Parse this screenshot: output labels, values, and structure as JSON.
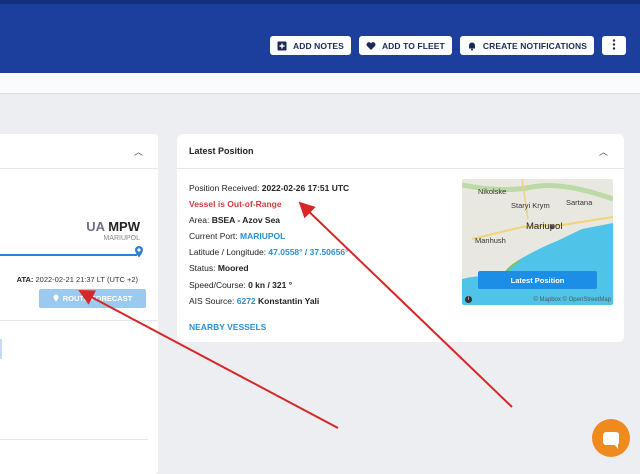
{
  "header": {
    "buttons": {
      "add_notes": "ADD NOTES",
      "add_to_fleet": "ADD TO FLEET",
      "create_notifications": "CREATE NOTIFICATIONS"
    },
    "more_icon": "vertical-dots-icon"
  },
  "voyage": {
    "dest_prefix": "UA",
    "dest_code": "MPW",
    "dest_name": "MARIUPOL",
    "ata_label": "ATA:",
    "ata_value": "2022-02-21 21:37 LT (UTC +2)",
    "route_button": "ROUTE FORECAST"
  },
  "latest_position": {
    "title": "Latest Position",
    "position_received_label": "Position Received:",
    "position_received_value": "2022-02-26 17:51 UTC",
    "status_warning": "Vessel is Out-of-Range",
    "area_label": "Area:",
    "area_value": "BSEA - Azov Sea",
    "port_label": "Current Port:",
    "port_value": "MARIUPOL",
    "latlon_label": "Latitude / Longitude:",
    "latlon_value": "47.0558° / 37.50656°",
    "status_label": "Status:",
    "status_value": "Moored",
    "speed_label": "Speed/Course:",
    "speed_value": "0 kn / 321 °",
    "ais_label": "AIS Source:",
    "ais_id": "6272",
    "ais_name": "Konstantin Yali",
    "nearby": "NEARBY VESSELS"
  },
  "map": {
    "places": [
      "Nikolske",
      "Staryi Krym",
      "Sartana",
      "Mariupol",
      "Manhush"
    ],
    "button": "Latest Position",
    "attribution": "© Mapbox © OpenStreetMap"
  },
  "colors": {
    "header": "#1c3f9e",
    "warning": "#d63a3a",
    "link": "#2b8fd6",
    "annotation_arrow": "#d92626",
    "chat": "#ef8a1e"
  }
}
